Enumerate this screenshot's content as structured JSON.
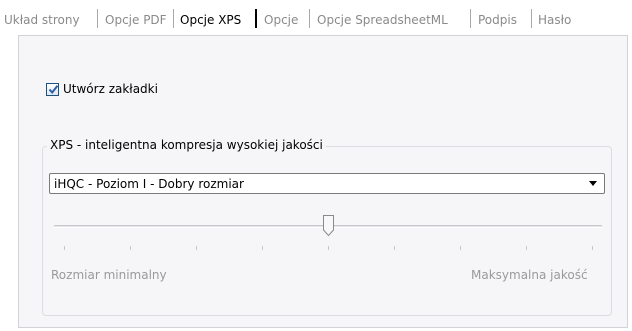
{
  "tabs": [
    {
      "label": "Układ strony",
      "active": false
    },
    {
      "label": "Opcje PDF",
      "active": false
    },
    {
      "label": "Opcje XPS",
      "active": true
    },
    {
      "label": "Opcje",
      "active": false
    },
    {
      "label": "Opcje SpreadsheetML",
      "active": false
    },
    {
      "label": "Podpis",
      "active": false
    },
    {
      "label": "Hasło",
      "active": false
    }
  ],
  "options": {
    "create_bookmarks_label": "Utwórz zakładki",
    "create_bookmarks_checked": true
  },
  "compression": {
    "group_title": "XPS - inteligentna kompresja wysokiej jakości",
    "selected_value": "iHQC - Poziom I - Dobry rozmiar",
    "slider": {
      "position": 0.5,
      "tick_count": 9,
      "min_label": "Rozmiar minimalny",
      "max_label": "Maksymalna jakość"
    }
  },
  "icons": {
    "checkbox_check": "checkmark-icon",
    "dropdown": "dropdown-arrow-icon",
    "slider_handle": "slider-thumb-icon"
  },
  "colors": {
    "panel_background": "#f6f6f8",
    "inactive_text": "#8a8a8a",
    "checkbox_check": "#2a5da8"
  }
}
